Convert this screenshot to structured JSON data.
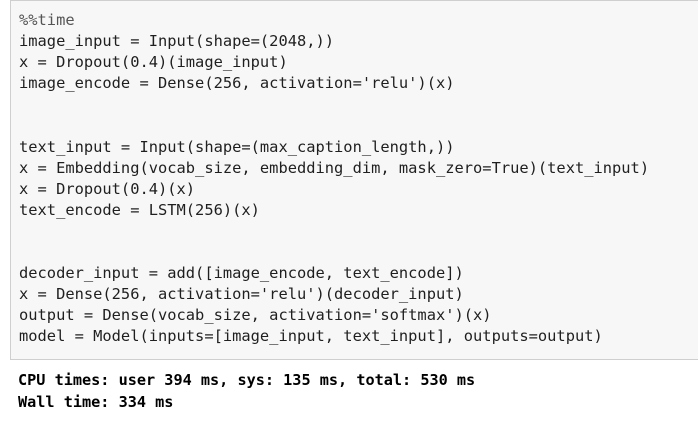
{
  "cell": {
    "code_lines": [
      "%%time",
      "image_input = Input(shape=(2048,))",
      "x = Dropout(0.4)(image_input)",
      "image_encode = Dense(256, activation='relu')(x)",
      "",
      "",
      "text_input = Input(shape=(max_caption_length,))",
      "x = Embedding(vocab_size, embedding_dim, mask_zero=True)(text_input)",
      "x = Dropout(0.4)(x)",
      "text_encode = LSTM(256)(x)",
      "",
      "",
      "decoder_input = add([image_encode, text_encode])",
      "x = Dense(256, activation='relu')(decoder_input)",
      "output = Dense(vocab_size, activation='softmax')(x)",
      "model = Model(inputs=[image_input, text_input], outputs=output)"
    ]
  },
  "output": {
    "cpu_times": "CPU times: user 394 ms, sys: 135 ms, total: 530 ms",
    "wall_time": "Wall time: 334 ms"
  },
  "colors": {
    "cell_background": "#f7f7f7",
    "cell_border": "#cfcfcf",
    "code_text": "#1f1f1f",
    "output_text": "#000000"
  }
}
